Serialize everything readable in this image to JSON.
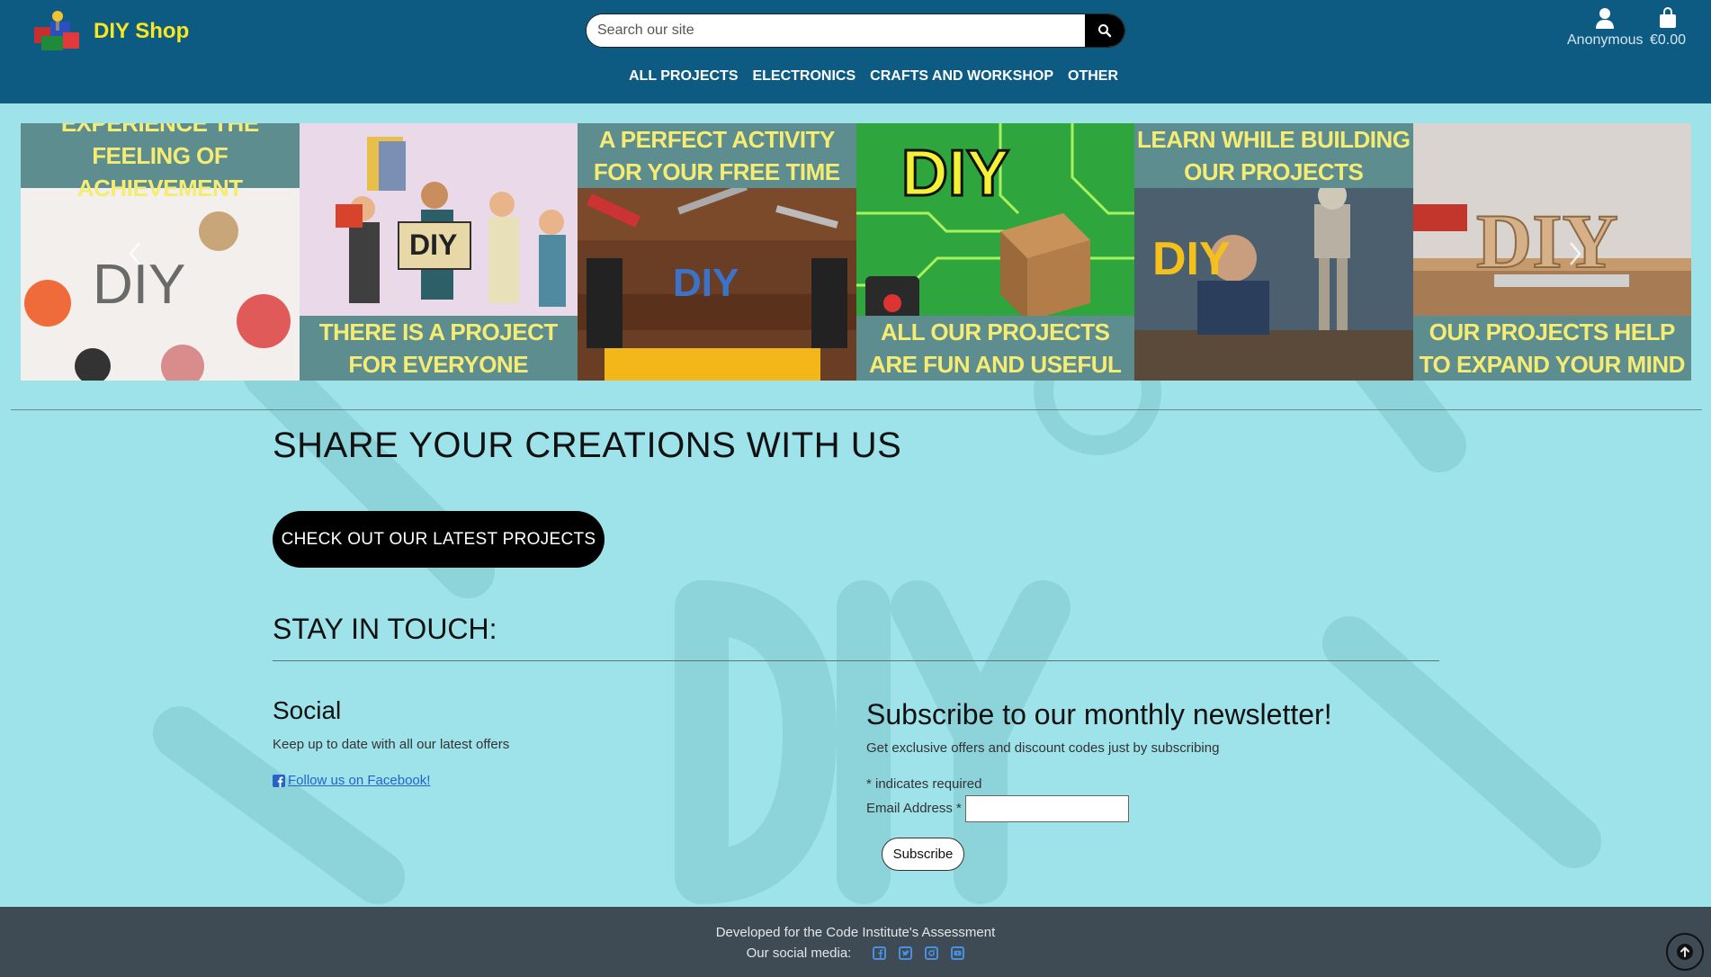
{
  "brand": {
    "name": "DIY Shop"
  },
  "search": {
    "placeholder": "Search our site"
  },
  "account": {
    "label": "Anonymous"
  },
  "bag": {
    "total": "€0.00"
  },
  "nav": {
    "items": [
      "ALL PROJECTS",
      "ELECTRONICS",
      "CRAFTS AND WORKSHOP",
      "OTHER"
    ]
  },
  "carousel": {
    "tiles": [
      {
        "caption": "EXPERIENCE THE FEELING OF ACHIEVEMENT",
        "caption_pos": "top",
        "image_word": "DIY"
      },
      {
        "caption": "THERE IS A PROJECT FOR EVERYONE",
        "caption_pos": "bottom",
        "image_word": "DIY"
      },
      {
        "caption": "A PERFECT ACTIVITY FOR YOUR FREE TIME",
        "caption_pos": "top",
        "image_word": "DIY"
      },
      {
        "caption": "ALL OUR PROJECTS ARE FUN AND USEFUL",
        "caption_pos": "bottom",
        "image_word": "DIY"
      },
      {
        "caption": "LEARN WHILE BUILDING OUR PROJECTS",
        "caption_pos": "top",
        "image_word": "DIY"
      },
      {
        "caption": "OUR PROJECTS HELP TO EXPAND YOUR MIND",
        "caption_pos": "bottom",
        "image_word": "DIY"
      }
    ]
  },
  "main": {
    "share_title": "SHARE YOUR CREATIONS WITH US",
    "cta_label": "CHECK OUT OUR LATEST PROJECTS",
    "stay_title": "STAY IN TOUCH:"
  },
  "social": {
    "title": "Social",
    "text": "Keep up to date with all our latest offers",
    "fb_link": "Follow us on Facebook!"
  },
  "newsletter": {
    "title": "Subscribe to our monthly newsletter!",
    "text": "Get exclusive offers and discount codes just by subscribing",
    "required_note": "* indicates required",
    "email_label": "Email Address",
    "required_mark": "*",
    "subscribe_label": "Subscribe"
  },
  "footer": {
    "developed": "Developed for the Code Institute's Assessment",
    "social_label": "Our social media:",
    "icons": [
      "facebook-icon",
      "twitter-icon",
      "instagram-icon",
      "youtube-icon"
    ]
  },
  "colors": {
    "header_bg": "#0d5b83",
    "page_bg": "#9ee3ea",
    "brand_yellow": "#f7e81f",
    "caption_bg": "#5e8d8f",
    "caption_text": "#f5ec74",
    "footer_bg": "#3e4b55",
    "link_blue": "#2563c9"
  }
}
